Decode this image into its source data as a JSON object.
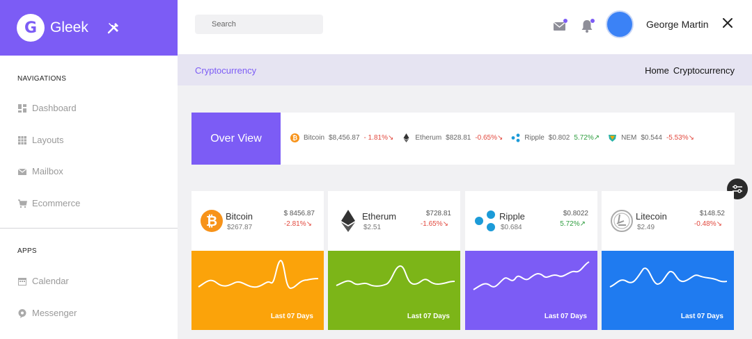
{
  "brand": {
    "logo_letter": "G",
    "name": "Gleek",
    "color": "#7c5cf5"
  },
  "header": {
    "search": {
      "placeholder": "Search"
    },
    "user_name": "George Martin"
  },
  "sidebar": {
    "sections": [
      {
        "heading": "NAVIGATIONS",
        "items": [
          {
            "label": "Dashboard",
            "icon": "dashboard-icon"
          },
          {
            "label": "Layouts",
            "icon": "layouts-icon"
          },
          {
            "label": "Mailbox",
            "icon": "mail-icon"
          },
          {
            "label": "Ecommerce",
            "icon": "cart-icon"
          }
        ]
      },
      {
        "heading": "APPS",
        "items": [
          {
            "label": "Calendar",
            "icon": "calendar-icon"
          },
          {
            "label": "Messenger",
            "icon": "messenger-icon"
          }
        ]
      }
    ]
  },
  "breadcrumb": {
    "title": "Cryptocurrency",
    "trail": [
      "Home",
      "Cryptocurrency"
    ]
  },
  "overview": {
    "label": "Over View",
    "tickers": [
      {
        "name": "Bitcoin",
        "price": "$8,456.87",
        "change": "- 1.81%",
        "trend": "down",
        "icon": "bitcoin-icon"
      },
      {
        "name": "Etherum",
        "price": "$828.81",
        "change": "-0.65%",
        "trend": "down",
        "icon": "ethereum-icon"
      },
      {
        "name": "Ripple",
        "price": "$0.802",
        "change": "5.72%",
        "trend": "up",
        "icon": "ripple-icon"
      },
      {
        "name": "NEM",
        "price": "$0.544",
        "change": "-5.53%",
        "trend": "down",
        "icon": "nem-icon"
      }
    ]
  },
  "cards": [
    {
      "name": "Bitcoin",
      "sub": "$267.87",
      "price": "$ 8456.87",
      "change": "-2.81%",
      "trend": "down",
      "color": "#fba30a",
      "icon": "bitcoin-icon",
      "footer": "Last 07 Days"
    },
    {
      "name": "Etherum",
      "sub": "$2.51",
      "price": "$728.81",
      "change": "-1.65%",
      "trend": "down",
      "color": "#7cb518",
      "icon": "ethereum-icon",
      "footer": "Last 07 Days"
    },
    {
      "name": "Ripple",
      "sub": "$0.684",
      "price": "$0.8022",
      "change": "5.72%",
      "trend": "up",
      "color": "#7c5cf5",
      "icon": "ripple-icon",
      "footer": "Last 07 Days"
    },
    {
      "name": "Litecoin",
      "sub": "$2.49",
      "price": "$148.52",
      "change": "-0.48%",
      "trend": "down",
      "color": "#1f7bf0",
      "icon": "litecoin-icon",
      "footer": "Last 07 Days"
    }
  ]
}
